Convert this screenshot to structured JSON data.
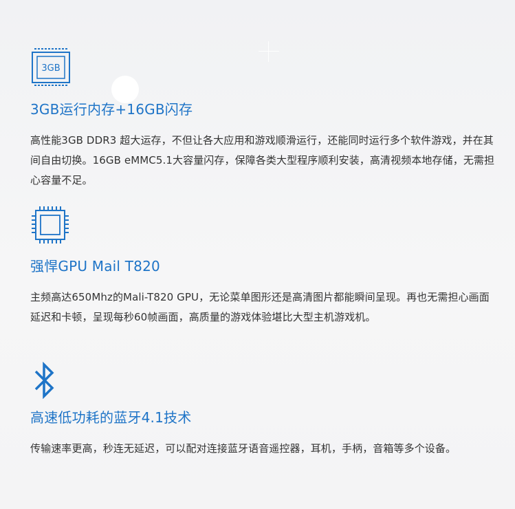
{
  "sections": [
    {
      "icon": "memory-chip-icon",
      "icon_label": "3GB",
      "title": "3GB运行内存+16GB闪存",
      "body": "高性能3GB DDR3 超大运存，不但让各大应用和游戏顺滑运行，还能同时运行多个软件游戏，并在其间自由切换。16GB eMMC5.1大容量闪存，保障各类大型程序顺利安装，高清视频本地存储，无需担心容量不足。"
    },
    {
      "icon": "processor-chip-icon",
      "title": "强悍GPU Mail T820",
      "body": "主频高达650Mhz的Mali-T820 GPU，无论菜单图形还是高清图片都能瞬间呈现。再也无需担心画面延迟和卡顿，呈现每秒60帧画面，高质量的游戏体验堪比大型主机游戏机。"
    },
    {
      "icon": "bluetooth-icon",
      "title": "高速低功耗的蓝牙4.1技术",
      "body": "传输速率更高，秒连无延迟，可以配对连接蓝牙语音遥控器，耳机，手柄，音箱等多个设备。"
    }
  ],
  "colors": {
    "accent": "#1e74c7",
    "text": "#333333",
    "background": "#f3f4f6"
  }
}
